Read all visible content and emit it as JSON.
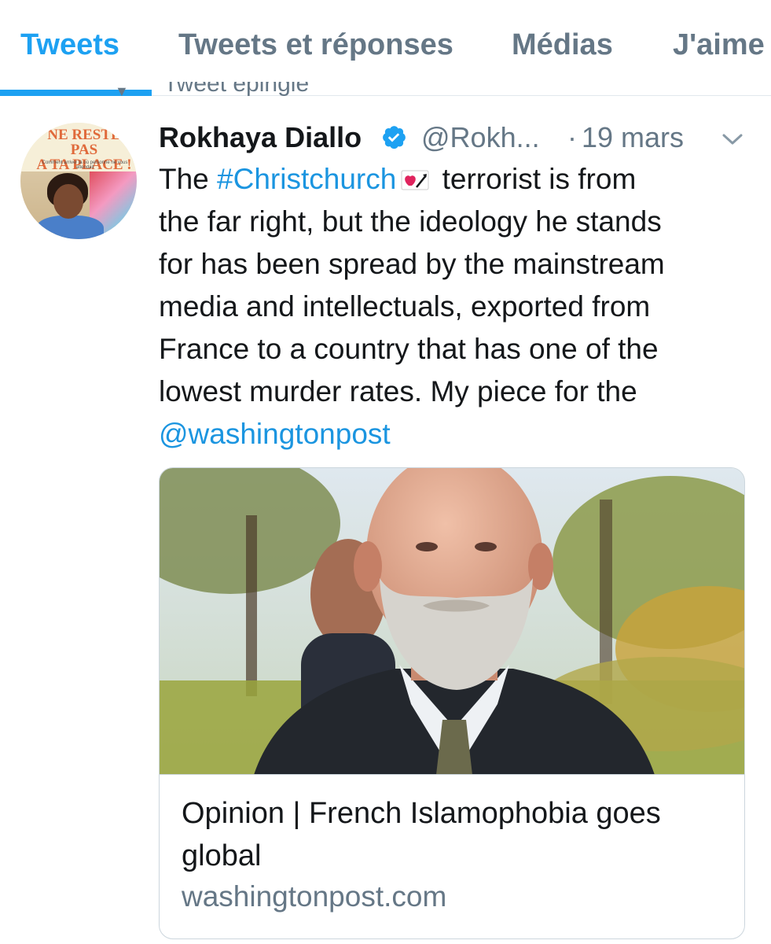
{
  "tabs": [
    {
      "label": "Tweets",
      "active": true
    },
    {
      "label": "Tweets et réponses",
      "active": false
    },
    {
      "label": "Médias",
      "active": false
    },
    {
      "label": "J'aime",
      "active": false
    }
  ],
  "pinned": {
    "icon": "pin-icon",
    "label": "Tweet épinglé"
  },
  "avatar": {
    "book_title": "NE RESTE PAS\nA TA PLACE !",
    "book_subtitle": "Comment arriver là où personne ne vous attendait"
  },
  "tweet": {
    "display_name": "Rokhaya Diallo",
    "verified": true,
    "handle": "@Rokh...",
    "separator": "·",
    "timestamp": "19 mars",
    "body": {
      "line1_prefix": "The ",
      "hashtag": "#Christchurch",
      "flag_emoji": "new-zealand-flag-heart-emoji",
      "line1_suffix": " terrorist is from",
      "line2": "the far right, but the ideology he stands",
      "line3": "for has been spread by the mainstream",
      "line4": "media and intellectuals, exported from",
      "line5": "France to a country that has one of the",
      "line6": "lowest murder rates. My piece for the",
      "mention": "@washingtonpost"
    }
  },
  "card": {
    "image": "photo-bearded-man",
    "title": "Opinion | French Islamophobia goes global",
    "domain": "washingtonpost.com"
  },
  "colors": {
    "accent": "#1da1f2",
    "link": "#1b95e0",
    "text": "#14171a",
    "secondary": "#657786",
    "border": "#ccd6dd"
  }
}
